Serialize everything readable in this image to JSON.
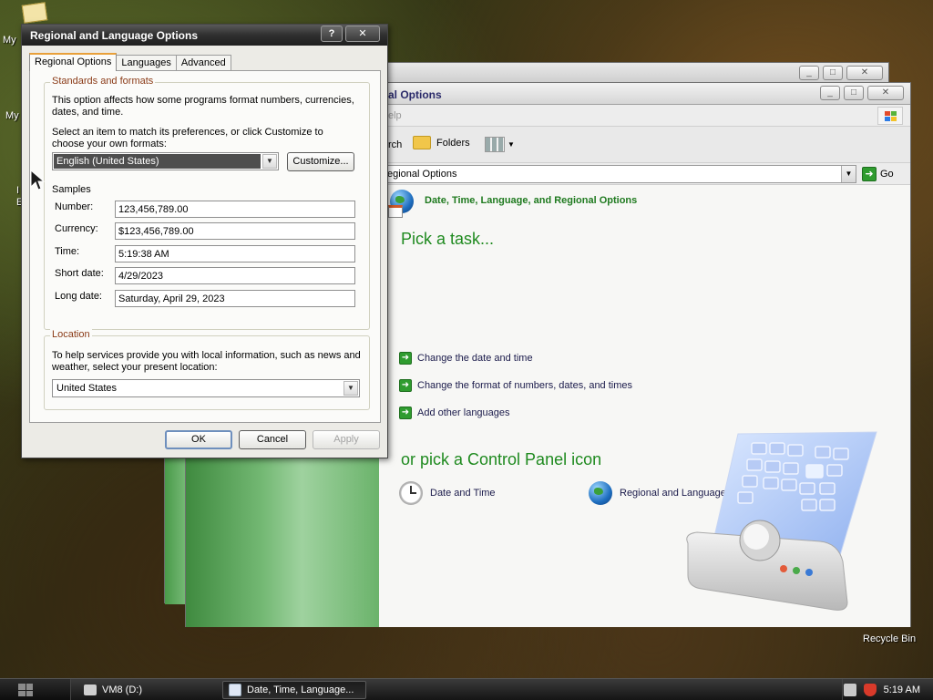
{
  "desktop": {
    "icons": [
      "My",
      "My",
      "I",
      "E"
    ],
    "recycle_bin": "Recycle Bin"
  },
  "control_panel": {
    "title_fragment": "al Options",
    "menu_fragment": "elp",
    "toolbar": {
      "search_fragment": "rch",
      "folders": "Folders"
    },
    "address_value": "egional Options",
    "go_label": "Go",
    "category_title": "Date, Time, Language, and Regional Options",
    "pick_task_heading": "Pick a task...",
    "tasks": [
      "Change the date and time",
      "Change the format of numbers, dates, and times",
      "Add other languages"
    ],
    "pick_icon_heading": "or pick a Control Panel icon",
    "icons": [
      "Date and Time",
      "Regional and Language Options"
    ]
  },
  "dialog": {
    "title": "Regional and Language Options",
    "help_btn": "?",
    "close_btn": "✕",
    "tabs": [
      "Regional Options",
      "Languages",
      "Advanced"
    ],
    "standards": {
      "group_label": "Standards and formats",
      "desc": "This option affects how some programs format numbers, currencies, dates, and time.",
      "select_desc": "Select an item to match its preferences, or click Customize to choose your own formats:",
      "selected_locale": "English (United States)",
      "customize_label": "Customize...",
      "samples_label": "Samples",
      "samples": [
        {
          "label": "Number:",
          "value": "123,456,789.00"
        },
        {
          "label": "Currency:",
          "value": "$123,456,789.00"
        },
        {
          "label": "Time:",
          "value": "5:19:38 AM"
        },
        {
          "label": "Short date:",
          "value": "4/29/2023"
        },
        {
          "label": "Long date:",
          "value": "Saturday, April 29, 2023"
        }
      ]
    },
    "location": {
      "group_label": "Location",
      "desc": "To help services provide you with local information, such as news and weather, select your present location:",
      "value": "United States"
    },
    "buttons": {
      "ok": "OK",
      "cancel": "Cancel",
      "apply": "Apply"
    }
  },
  "taskbar": {
    "items": [
      "VM8 (D:)",
      "Date, Time, Language..."
    ],
    "clock": "5:19 AM"
  }
}
